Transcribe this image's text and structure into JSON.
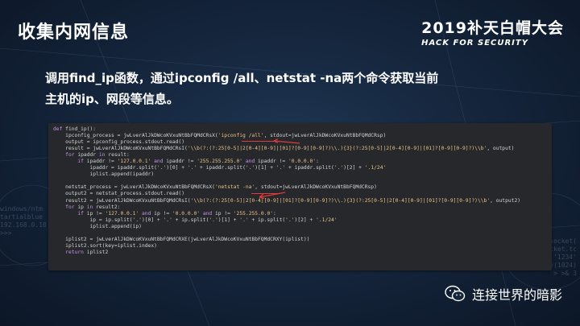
{
  "slide": {
    "title": "收集内网信息",
    "description_line1": "调用find_ip函数，通过ipconfig /all、netstat -na两个命令获取当前",
    "description_line2": "主机的ip、网段等信息。"
  },
  "logo": {
    "year_text": "2019补天白帽大会",
    "subtitle": "HACK FOR SECURITY"
  },
  "code": {
    "lines": [
      "def find_ip():",
      "    ipconfig_process = jwLverAlJkDWcoKVxuNtBbFQMdCRsX('ipconfig /all', stdout=jwLverAlJkDWcoKVxuNtBbFQMdCRsp)",
      "    output = ipconfig_process.stdout.read()",
      "    result = jwLverAlJkDWcoKVxuNtBbFQMdCRsI('\\\\b(?:(?:25[0-5]|2[0-4][0-9]|[01]?[0-9][0-9]?)\\\\.){3}(?:25[0-5]|2[0-4][0-9]|[01]?[0-9][0-9]?)\\\\b', output)",
      "    for ipaddr in result:",
      "        if ipaddr != '127.0.0.1' and ipaddr != '255.255.255.0' and ipaddr != '0.0.0.0':",
      "            ipaddr = ipaddr.split('.')[0] + '.' + ipaddr.split('.')[1] + '.' + ipaddr.split('.')[2] + '.1/24'",
      "            iplist.append(ipaddr)",
      "",
      "    netstat_process = jwLverAlJkDWcoKVxuNtBbFQMdCRsX('netstat -na', stdout=jwLverAlJkDWcoKVxuNtBbFQMdCRsp)",
      "    output2 = netstat_process.stdout.read()",
      "    result2 = jwLverAlJkDWcoKVxuNtBbFQMdCRsI('\\\\b(?:(?:25[0-5]|2[0-4][0-9]|[01]?[0-9][0-9]?)\\\\.){3}(?:25[0-5]|2[0-4][0-9]|[01]?[0-9][0-9]?)\\\\b', output2)",
      "    for ip in result2:",
      "        if ip != '127.0.0.1' and ip != '0.0.0.0' and ip != '255.255.0.0':",
      "            ip = ip.split('.')[0] + '.' + ip.split('.')[1] + '.' + ip.split('.')[2] + '.1/24'",
      "            iplist.append(ip)",
      "",
      "    iplist2 = jwLverAlJkDWcoKVxuNtBbFQMdCRXE(jwLverAlJkDWcoKVxuNtBbFQMdCRXY(iplist))",
      "    iplist2.sort(key=iplist.index)",
      "    return iplist2"
    ]
  },
  "watermark": {
    "text": "连接世界的暗影",
    "icon": "wechat-icon"
  },
  "colors": {
    "accent_red": "#e03c3c",
    "code_bg": "#26282b"
  }
}
